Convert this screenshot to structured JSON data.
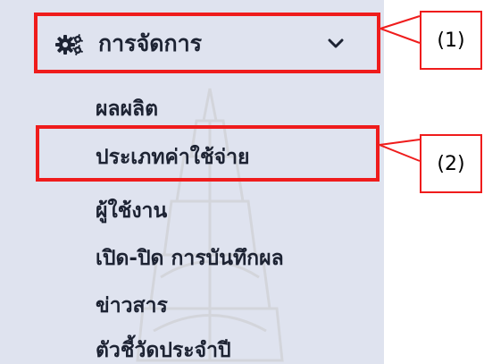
{
  "menu": {
    "header_label": "การจัดการ",
    "header_icon": "gears-icon",
    "toggle_icon": "chevron-down-icon",
    "items": [
      {
        "label": "ผลผลิต"
      },
      {
        "label": "ประเภทค่าใช้จ่าย"
      },
      {
        "label": "ผู้ใช้งาน"
      },
      {
        "label": "เปิด-ปิด การบันทึกผล"
      },
      {
        "label": "ข่าวสาร"
      },
      {
        "label": "ตัวชี้วัดประจำปี"
      }
    ]
  },
  "annotations": {
    "callout_1": "(1)",
    "callout_2": "(2)",
    "highlight_color": "#ef1c1c"
  },
  "colors": {
    "sidebar_bg": "#dfe3ef",
    "text": "#1d2333"
  }
}
